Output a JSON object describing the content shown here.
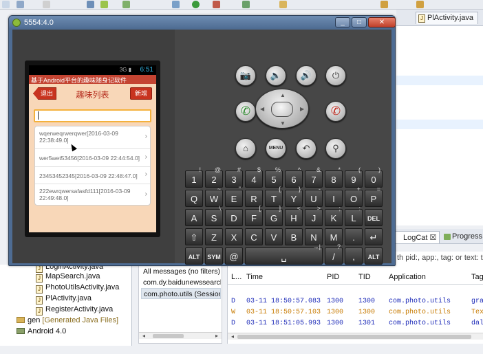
{
  "ide": {
    "editor_tab": "PlActivity.java",
    "package_explorer": {
      "rows": [
        {
          "label": "LoginActivity.java"
        },
        {
          "label": "MapSearch.java"
        },
        {
          "label": "PhotoUtilsActivity.java"
        },
        {
          "label": "PlActivity.java"
        },
        {
          "label": "RegisterActivity.java"
        }
      ],
      "gen_label": "gen",
      "gen_suffix": "[Generated Java Files]",
      "android_label": "Android 4.0"
    },
    "logcat": {
      "tab_label": "LogCat",
      "progress_tab_label": "Progress",
      "filter_hint": "th pid:, app:, tag: or text: to",
      "filters": [
        {
          "label": "All messages (no filters)"
        },
        {
          "label": "com.dy.baidunewssearch"
        },
        {
          "label": "com.photo.utils (Session)"
        }
      ],
      "columns": {
        "level": "L...",
        "time": "Time",
        "pid": "PID",
        "tid": "TID",
        "application": "Application",
        "tag": "Tag"
      },
      "rows": [
        {
          "level": "D",
          "time": "03-11 18:50:57.083",
          "pid": "1300",
          "tid": "1300",
          "app": "com.photo.utils",
          "tag": "gra",
          "color": "#1c2ab8"
        },
        {
          "level": "W",
          "time": "03-11 18:50:57.103",
          "pid": "1300",
          "tid": "1300",
          "app": "com.photo.utils",
          "tag": "Tex",
          "color": "#c77a00"
        },
        {
          "level": "D",
          "time": "03-11 18:51:05.993",
          "pid": "1300",
          "tid": "1301",
          "app": "com.photo.utils",
          "tag": "dal",
          "color": "#1c2ab8"
        }
      ]
    }
  },
  "emulator": {
    "window_title": "5554:4.0",
    "status_time": "6:51",
    "status_icons": "3G ▮",
    "app_title": "基于Android平台的趣味随身记软件",
    "back_label": "退出",
    "header_title": "趣味列表",
    "add_label": "新增",
    "search_value": "",
    "list_items": [
      {
        "text": "wqerweqrwerqwer[2016-03-09 22:38:49.0]"
      },
      {
        "text": "wer5wet53456[2016-03-09 22:44:54.0]"
      },
      {
        "text": "23453452345[2016-03-09 22:48:47.0]"
      },
      {
        "text": "222ewrqwersafasfd111[2016-03-09 22:49:48.0]"
      }
    ],
    "controls": {
      "camera": "📷",
      "vol_down": "🔈",
      "vol_up": "🔊",
      "power": "⏻",
      "call": "✆",
      "end": "✆",
      "home": "⌂",
      "menu": "MENU",
      "back": "↶",
      "search": "⚲"
    },
    "keyboard": {
      "row1": [
        {
          "k": "1",
          "s": "!"
        },
        {
          "k": "2",
          "s": "@"
        },
        {
          "k": "3",
          "s": "#"
        },
        {
          "k": "4",
          "s": "$"
        },
        {
          "k": "5",
          "s": "%"
        },
        {
          "k": "6",
          "s": "^"
        },
        {
          "k": "7",
          "s": "&"
        },
        {
          "k": "8",
          "s": "*"
        },
        {
          "k": "9",
          "s": "("
        },
        {
          "k": "0",
          "s": ")"
        }
      ],
      "row2": [
        {
          "k": "Q",
          "s": ""
        },
        {
          "k": "W",
          "s": "~"
        },
        {
          "k": "E",
          "s": "\""
        },
        {
          "k": "R",
          "s": ""
        },
        {
          "k": "T",
          "s": "{"
        },
        {
          "k": "Y",
          "s": "}"
        },
        {
          "k": "U",
          "s": "-"
        },
        {
          "k": "I",
          "s": ""
        },
        {
          "k": "O",
          "s": "+"
        },
        {
          "k": "P",
          "s": "="
        }
      ],
      "row3": [
        {
          "k": "A",
          "s": ""
        },
        {
          "k": "S",
          "s": "\\"
        },
        {
          "k": "D",
          "s": ""
        },
        {
          "k": "F",
          "s": "["
        },
        {
          "k": "G",
          "s": "]"
        },
        {
          "k": "H",
          "s": "<"
        },
        {
          "k": "J",
          "s": ">"
        },
        {
          "k": "K",
          "s": ";"
        },
        {
          "k": "L",
          "s": ":"
        },
        {
          "k": "DEL",
          "s": ""
        }
      ],
      "row4": [
        {
          "k": "⇧",
          "s": ""
        },
        {
          "k": "Z",
          "s": ""
        },
        {
          "k": "X",
          "s": ""
        },
        {
          "k": "C",
          "s": ""
        },
        {
          "k": "V",
          "s": ""
        },
        {
          "k": "B",
          "s": ""
        },
        {
          "k": "N",
          "s": ""
        },
        {
          "k": "M",
          "s": ""
        },
        {
          "k": ".",
          "s": ""
        },
        {
          "k": "↵",
          "s": ""
        }
      ],
      "row5": [
        {
          "k": "ALT",
          "s": ""
        },
        {
          "k": "SYM",
          "s": ""
        },
        {
          "k": "@",
          "s": ""
        },
        {
          "k": "␣",
          "s": "→|"
        },
        {
          "k": "/",
          "s": "?"
        },
        {
          "k": ",",
          "s": ""
        },
        {
          "k": "ALT",
          "s": ""
        }
      ]
    }
  }
}
